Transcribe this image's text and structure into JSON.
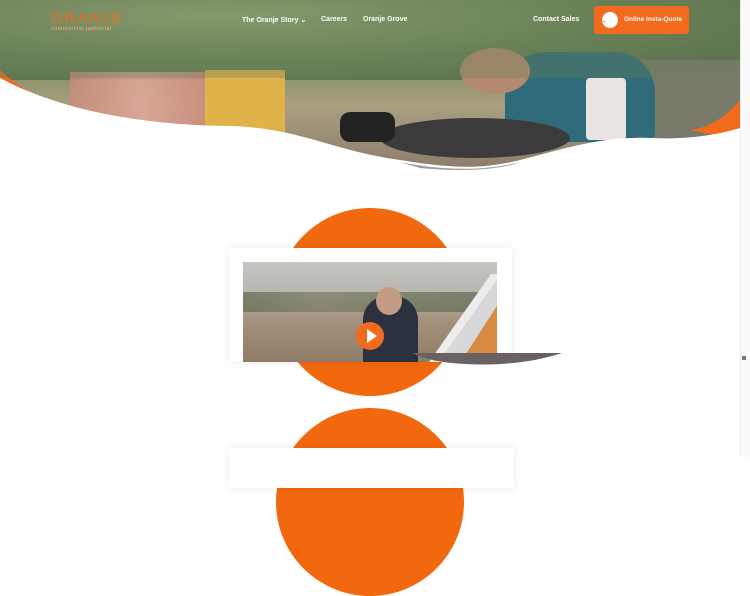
{
  "header": {
    "logo": {
      "name": "ORANJE",
      "tagline": "commercial janitorial"
    },
    "nav": [
      {
        "label": "The Oranje Story",
        "has_dropdown": true
      },
      {
        "label": "Careers"
      },
      {
        "label": "Oranje Grove"
      }
    ],
    "contact_label": "Contact Sales",
    "quote_button": {
      "label": "Online Insta-Quote",
      "icon": "arrow-right-icon"
    }
  },
  "colors": {
    "accent": "#f26a1b",
    "accent_light": "#f7b07f",
    "white": "#ffffff"
  },
  "video": {
    "play_icon": "play-icon"
  }
}
